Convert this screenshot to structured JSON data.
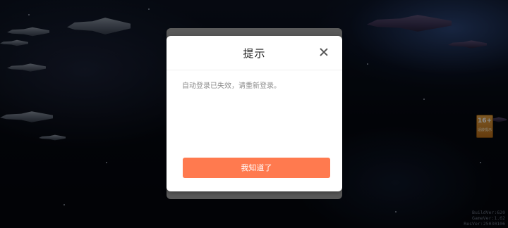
{
  "dialog": {
    "title": "提示",
    "message": "自动登录已失效，请重新登录。",
    "confirm_label": "我知道了",
    "close_icon": "close-icon"
  },
  "age_rating": {
    "value": "16+",
    "label": "适龄提示"
  },
  "version_info": {
    "build": "BuildVer:620",
    "game": "GameVer:1.62",
    "res": "ResVer:25030106"
  },
  "colors": {
    "accent": "#ff7a4f",
    "badge": "#e2a042"
  }
}
